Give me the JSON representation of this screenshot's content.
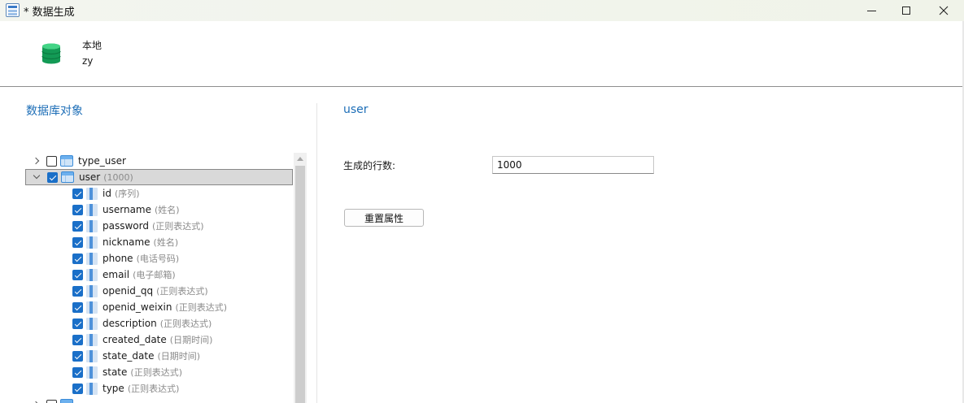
{
  "window": {
    "title": "* 数据生成",
    "app_icon": "data-generator-icon",
    "controls": [
      "minimize-icon",
      "maximize-icon",
      "close-icon"
    ]
  },
  "connection": {
    "icon": "database-icon",
    "name": "本地",
    "database": "zy"
  },
  "left_pane": {
    "title": "数据库对象",
    "tree": [
      {
        "type": "table",
        "label": "type_user",
        "hint": "",
        "expanded": false,
        "checked": false
      },
      {
        "type": "table",
        "label": "user",
        "hint": "(1000)",
        "expanded": true,
        "checked": true,
        "selected": true
      },
      {
        "type": "column",
        "label": "id",
        "hint": "(序列)",
        "checked": true
      },
      {
        "type": "column",
        "label": "username",
        "hint": "(姓名)",
        "checked": true
      },
      {
        "type": "column",
        "label": "password",
        "hint": "(正则表达式)",
        "checked": true
      },
      {
        "type": "column",
        "label": "nickname",
        "hint": "(姓名)",
        "checked": true
      },
      {
        "type": "column",
        "label": "phone",
        "hint": "(电话号码)",
        "checked": true
      },
      {
        "type": "column",
        "label": "email",
        "hint": "(电子邮箱)",
        "checked": true
      },
      {
        "type": "column",
        "label": "openid_qq",
        "hint": "(正则表达式)",
        "checked": true
      },
      {
        "type": "column",
        "label": "openid_weixin",
        "hint": "(正则表达式)",
        "checked": true
      },
      {
        "type": "column",
        "label": "description",
        "hint": "(正则表达式)",
        "checked": true
      },
      {
        "type": "column",
        "label": "created_date",
        "hint": "(日期时间)",
        "checked": true
      },
      {
        "type": "column",
        "label": "state_date",
        "hint": "(日期时间)",
        "checked": true
      },
      {
        "type": "column",
        "label": "state",
        "hint": "(正则表达式)",
        "checked": true
      },
      {
        "type": "column",
        "label": "type",
        "hint": "(正则表达式)",
        "checked": true
      },
      {
        "type": "table",
        "label": "",
        "hint": "",
        "expanded": false,
        "checked": false
      }
    ]
  },
  "right_pane": {
    "title": "user",
    "rows_label": "生成的行数:",
    "rows_value": "1000",
    "reset_button": "重置属性"
  },
  "colors": {
    "accent": "#1d6eb7",
    "checkbox": "#1a6fc8",
    "selected_row": "#d9d9d9"
  }
}
